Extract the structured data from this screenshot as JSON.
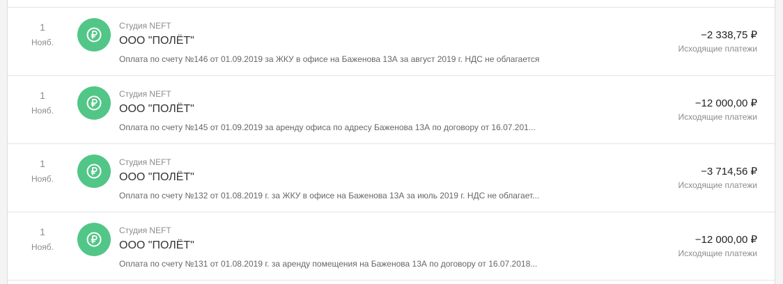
{
  "colors": {
    "avatar_bg": "#52c687",
    "icon_fg": "#ffffff",
    "muted_text": "#8c8c8c",
    "primary_text": "#333333"
  },
  "transactions": [
    {
      "day": "1",
      "month": "Нояб.",
      "icon": "ruble-icon",
      "company": "Студия NEFT",
      "counterparty": "ООО \"ПОЛЁТ\"",
      "purpose": "Оплата по счету №146 от 01.09.2019 за ЖКУ в офисе на Баженова 13А за август 2019 г. НДС не облагается",
      "amount": "−2 338,75 ₽",
      "category": "Исходящие платежи"
    },
    {
      "day": "1",
      "month": "Нояб.",
      "icon": "ruble-icon",
      "company": "Студия NEFT",
      "counterparty": "ООО \"ПОЛЁТ\"",
      "purpose": "Оплата по счету №145 от 01.09.2019 за аренду офиса по адресу Баженова 13А по договору от 16.07.201...",
      "amount": "−12 000,00 ₽",
      "category": "Исходящие платежи"
    },
    {
      "day": "1",
      "month": "Нояб.",
      "icon": "ruble-icon",
      "company": "Студия NEFT",
      "counterparty": "ООО \"ПОЛЁТ\"",
      "purpose": "Оплата по счету №132 от 01.08.2019 г. за ЖКУ в офисе на Баженова 13А за июль 2019 г. НДС не облагает...",
      "amount": "−3 714,56 ₽",
      "category": "Исходящие платежи"
    },
    {
      "day": "1",
      "month": "Нояб.",
      "icon": "ruble-icon",
      "company": "Студия NEFT",
      "counterparty": "ООО \"ПОЛЁТ\"",
      "purpose": "Оплата по счету №131 от 01.08.2019 г. за аренду помещения на Баженова 13А по договору от 16.07.2018...",
      "amount": "−12 000,00 ₽",
      "category": "Исходящие платежи"
    }
  ]
}
